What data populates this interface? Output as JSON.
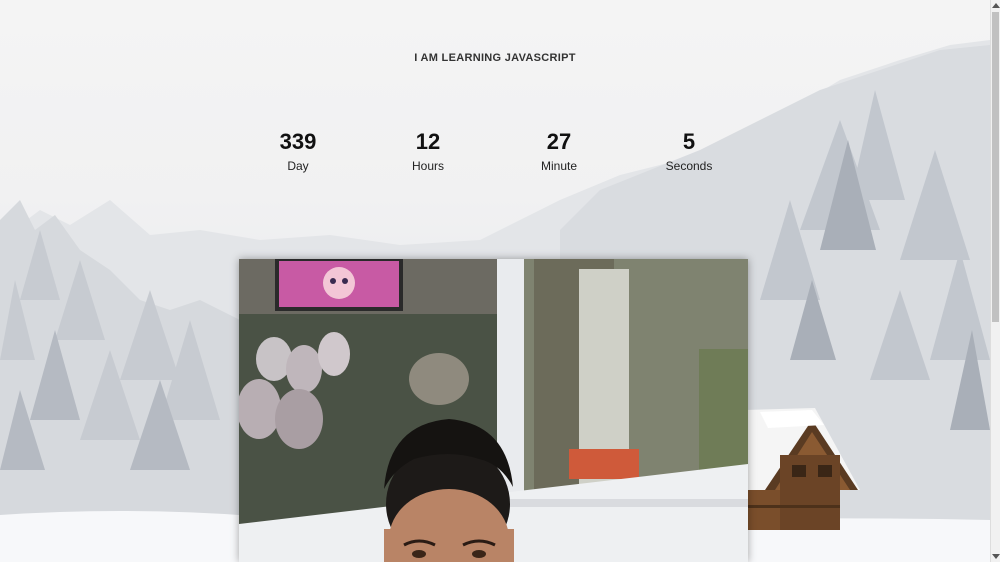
{
  "heading": "I AM LEARNING JAVASCRIPT",
  "countdown": [
    {
      "value": "339",
      "label": "Day"
    },
    {
      "value": "12",
      "label": "Hours"
    },
    {
      "value": "27",
      "label": "Minute"
    },
    {
      "value": "5",
      "label": "Seconds"
    }
  ],
  "colors": {
    "text": "#111111",
    "background": "#f2f3f5"
  },
  "icons": {
    "scroll_up": "chevron-up-icon",
    "scroll_down": "chevron-down-icon"
  }
}
